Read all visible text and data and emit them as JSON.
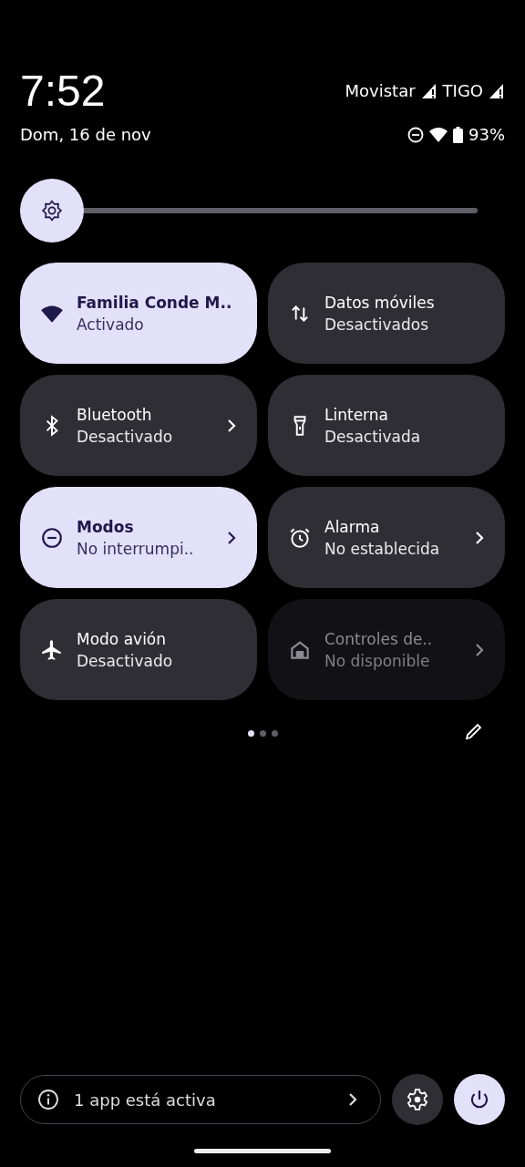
{
  "status_bar": {
    "time": "7:52",
    "date": "Dom, 16 de nov",
    "carriers": [
      "Movistar",
      "TIGO"
    ],
    "battery": "93%"
  },
  "tiles": [
    {
      "kind": "wifi",
      "title": "Familia Conde M..",
      "subtitle": "Activado",
      "on": true,
      "disabled": false,
      "chevron": false
    },
    {
      "kind": "data",
      "title": "Datos móviles",
      "subtitle": "Desactivados",
      "on": false,
      "disabled": false,
      "chevron": false
    },
    {
      "kind": "bluetooth",
      "title": "Bluetooth",
      "subtitle": "Desactivado",
      "on": false,
      "disabled": false,
      "chevron": true
    },
    {
      "kind": "flashlight",
      "title": "Linterna",
      "subtitle": "Desactivada",
      "on": false,
      "disabled": false,
      "chevron": false
    },
    {
      "kind": "dnd",
      "title": "Modos",
      "subtitle": "No interrumpi..",
      "on": true,
      "disabled": false,
      "chevron": true
    },
    {
      "kind": "alarm",
      "title": "Alarma",
      "subtitle": "No establecida",
      "on": false,
      "disabled": false,
      "chevron": true
    },
    {
      "kind": "airplane",
      "title": "Modo avión",
      "subtitle": "Desactivado",
      "on": false,
      "disabled": false,
      "chevron": false
    },
    {
      "kind": "home",
      "title": "Controles de..",
      "subtitle": "No disponible",
      "on": false,
      "disabled": true,
      "chevron": true
    }
  ],
  "pages": [
    {
      "selected": true
    },
    {
      "selected": false
    },
    {
      "selected": false
    }
  ],
  "footer": {
    "active_apps": "1 app está activa"
  }
}
